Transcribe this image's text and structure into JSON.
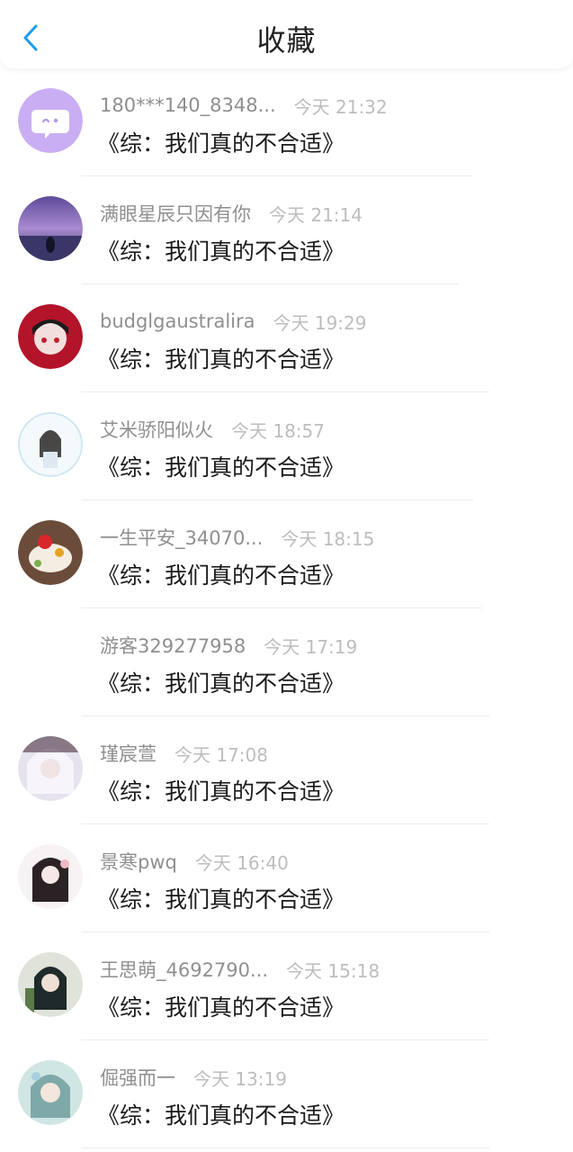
{
  "header": {
    "title": "收藏",
    "back_icon": "chevron-left-icon",
    "accent": "#1e9be8"
  },
  "items": [
    {
      "name": "180***140_8348...",
      "time": "今天 21:32",
      "book": "《综：我们真的不合适》",
      "avatar": "chat-bubble-default"
    },
    {
      "name": "满眼星辰只因有你",
      "time": "今天 21:14",
      "book": "《综：我们真的不合适》",
      "avatar": "photo"
    },
    {
      "name": "budglgaustralira",
      "time": "今天 19:29",
      "book": "《综：我们真的不合适》",
      "avatar": "photo"
    },
    {
      "name": "艾米骄阳似火",
      "time": "今天 18:57",
      "book": "《综：我们真的不合适》",
      "avatar": "photo"
    },
    {
      "name": "一生平安_34070...",
      "time": "今天 18:15",
      "book": "《综：我们真的不合适》",
      "avatar": "photo"
    },
    {
      "name": "游客329277958",
      "time": "今天 17:19",
      "book": "《综：我们真的不合适》",
      "avatar": "none"
    },
    {
      "name": "瑾宸萱",
      "time": "今天 17:08",
      "book": "《综：我们真的不合适》",
      "avatar": "photo"
    },
    {
      "name": "景寒pwq",
      "time": "今天 16:40",
      "book": "《综：我们真的不合适》",
      "avatar": "photo"
    },
    {
      "name": "王思萌_4692790...",
      "time": "今天 15:18",
      "book": "《综：我们真的不合适》",
      "avatar": "photo"
    },
    {
      "name": "倔强而一",
      "time": "今天 13:19",
      "book": "《综：我们真的不合适》",
      "avatar": "photo"
    }
  ]
}
